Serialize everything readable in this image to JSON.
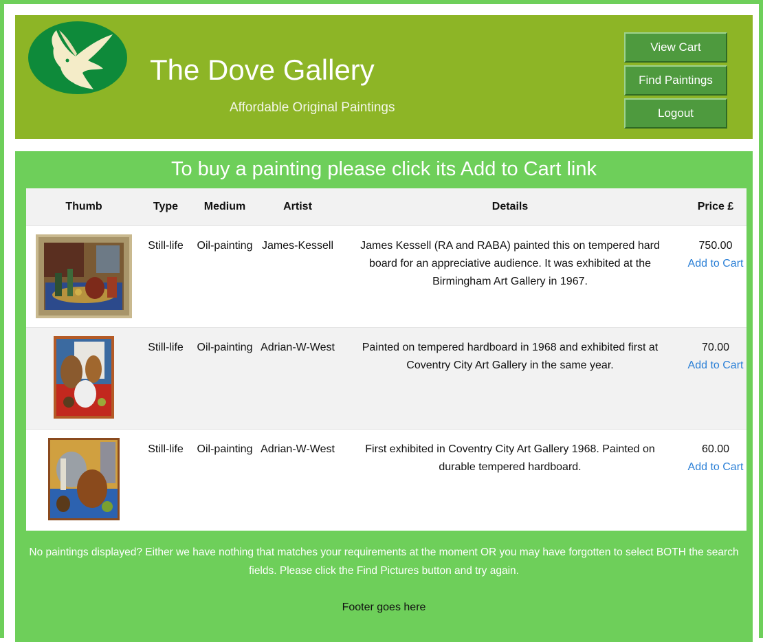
{
  "header": {
    "title": "The Dove Gallery",
    "tagline": "Affordable Original Paintings",
    "logo_icon": "dove-logo-icon"
  },
  "nav": {
    "view_cart": "View Cart",
    "find_paintings": "Find Paintings",
    "logout": "Logout"
  },
  "main": {
    "instruction": "To buy a painting please click its Add to Cart link",
    "columns": [
      "Thumb",
      "Type",
      "Medium",
      "Artist",
      "Details",
      "Price £"
    ],
    "rows": [
      {
        "type": "Still-life",
        "medium": "Oil-painting",
        "artist": "James-Kessell",
        "details": "James Kessell (RA and RABA) painted this on tempered hard board for an appreciative audience. It was exhibited at the Birmingham Art Gallery in 1967.",
        "price": "750.00",
        "add_label": "Add to Cart",
        "thumb_icon": "painting-thumbnail-icon"
      },
      {
        "type": "Still-life",
        "medium": "Oil-painting",
        "artist": "Adrian-W-West",
        "details": "Painted on tempered hardboard in 1968 and exhibited first at Coventry City Art Gallery in the same year.",
        "price": "70.00",
        "add_label": "Add to Cart",
        "thumb_icon": "painting-thumbnail-icon"
      },
      {
        "type": "Still-life",
        "medium": "Oil-painting",
        "artist": "Adrian-W-West",
        "details": "First exhibited in Coventry City Art Gallery 1968. Painted on durable tempered hardboard.",
        "price": "60.00",
        "add_label": "Add to Cart",
        "thumb_icon": "painting-thumbnail-icon"
      }
    ],
    "notice": "No paintings displayed? Either we have nothing that matches your requirements at the moment OR you may have forgotten to select BOTH the search fields. Please click the Find Pictures button and try again.",
    "footer": "Footer goes here"
  },
  "colors": {
    "header_bg": "#8db526",
    "main_bg": "#6ecf5a",
    "button_bg": "#4e9a3e",
    "link": "#2a7fd6"
  }
}
